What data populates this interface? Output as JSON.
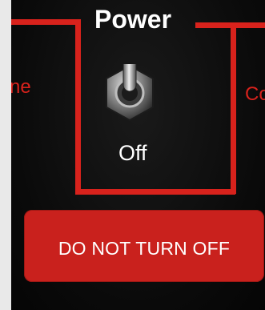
{
  "panel": {
    "title": "Power",
    "switch_state": "Off",
    "left_label": "ne",
    "right_label": "Co",
    "warning": "DO NOT TURN OFF"
  },
  "colors": {
    "panel": "#0b0b0b",
    "accent_red": "#d8221c",
    "label_red": "#c9211d",
    "text_white": "#ffffff",
    "background": "#e9e9e9"
  },
  "icons": {
    "switch": "toggle-switch-icon"
  }
}
